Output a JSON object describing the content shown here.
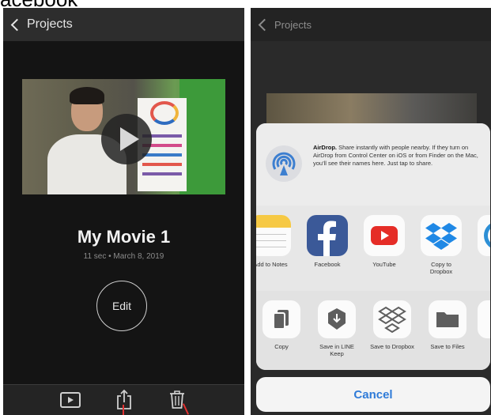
{
  "caption": "acebook",
  "left": {
    "nav": {
      "back_label": "Projects"
    },
    "movie": {
      "title": "My Movie 1",
      "meta": "11 sec • March 8, 2019"
    },
    "edit_label": "Edit",
    "toolbar": {
      "icons": [
        "play-preview-icon",
        "share-icon",
        "trash-icon"
      ]
    },
    "annotation_color": "#e23030"
  },
  "right": {
    "nav": {
      "back_label": "Projects"
    },
    "airdrop": {
      "title": "AirDrop.",
      "text": "Share instantly with people nearby. If they turn on AirDrop from Control Center on iOS or from Finder on the Mac, you'll see their names here. Just tap to share."
    },
    "apps": [
      {
        "label": "Add to Notes",
        "icon": "notes-icon"
      },
      {
        "label": "Facebook",
        "icon": "facebook-icon"
      },
      {
        "label": "YouTube",
        "icon": "youtube-icon"
      },
      {
        "label": "Copy to Dropbox",
        "icon": "dropbox-icon"
      },
      {
        "label": "Mo",
        "icon": "more-app-icon"
      }
    ],
    "actions": [
      {
        "label": "Copy",
        "icon": "copy-icon"
      },
      {
        "label": "Save in LINE Keep",
        "icon": "line-keep-icon"
      },
      {
        "label": "Save to Dropbox",
        "icon": "dropbox-icon"
      },
      {
        "label": "Save to Files",
        "icon": "folder-icon"
      },
      {
        "label": "",
        "icon": "more-action-icon"
      }
    ],
    "cancel_label": "Cancel",
    "colors": {
      "accent": "#2f7bd8",
      "facebook": "#3b5998",
      "youtube": "#e52d27",
      "dropbox": "#1f88e5"
    }
  }
}
